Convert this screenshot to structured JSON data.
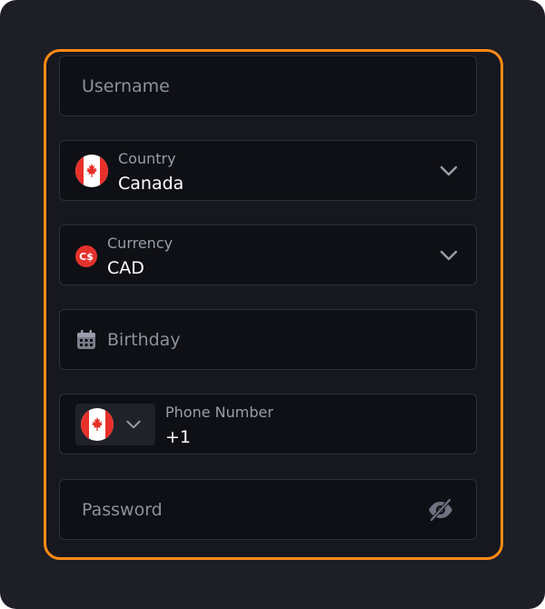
{
  "form": {
    "username": {
      "placeholder": "Username"
    },
    "country": {
      "label": "Country",
      "value": "Canada",
      "flag_icon": "canada-flag-icon"
    },
    "currency": {
      "label": "Currency",
      "value": "CAD",
      "badge": "C$"
    },
    "birthday": {
      "placeholder": "Birthday",
      "icon": "calendar-icon"
    },
    "phone": {
      "label": "Phone Number",
      "value": "+1",
      "flag_icon": "canada-flag-icon"
    },
    "password": {
      "placeholder": "Password",
      "icon": "eye-off-icon"
    }
  },
  "colors": {
    "accent": "#ff8a14",
    "background": "#1d1e26",
    "field": "#0f1015",
    "border": "#2e3039",
    "text": "#ffffff",
    "muted": "#8d909c",
    "canada_red": "#e7302a"
  }
}
